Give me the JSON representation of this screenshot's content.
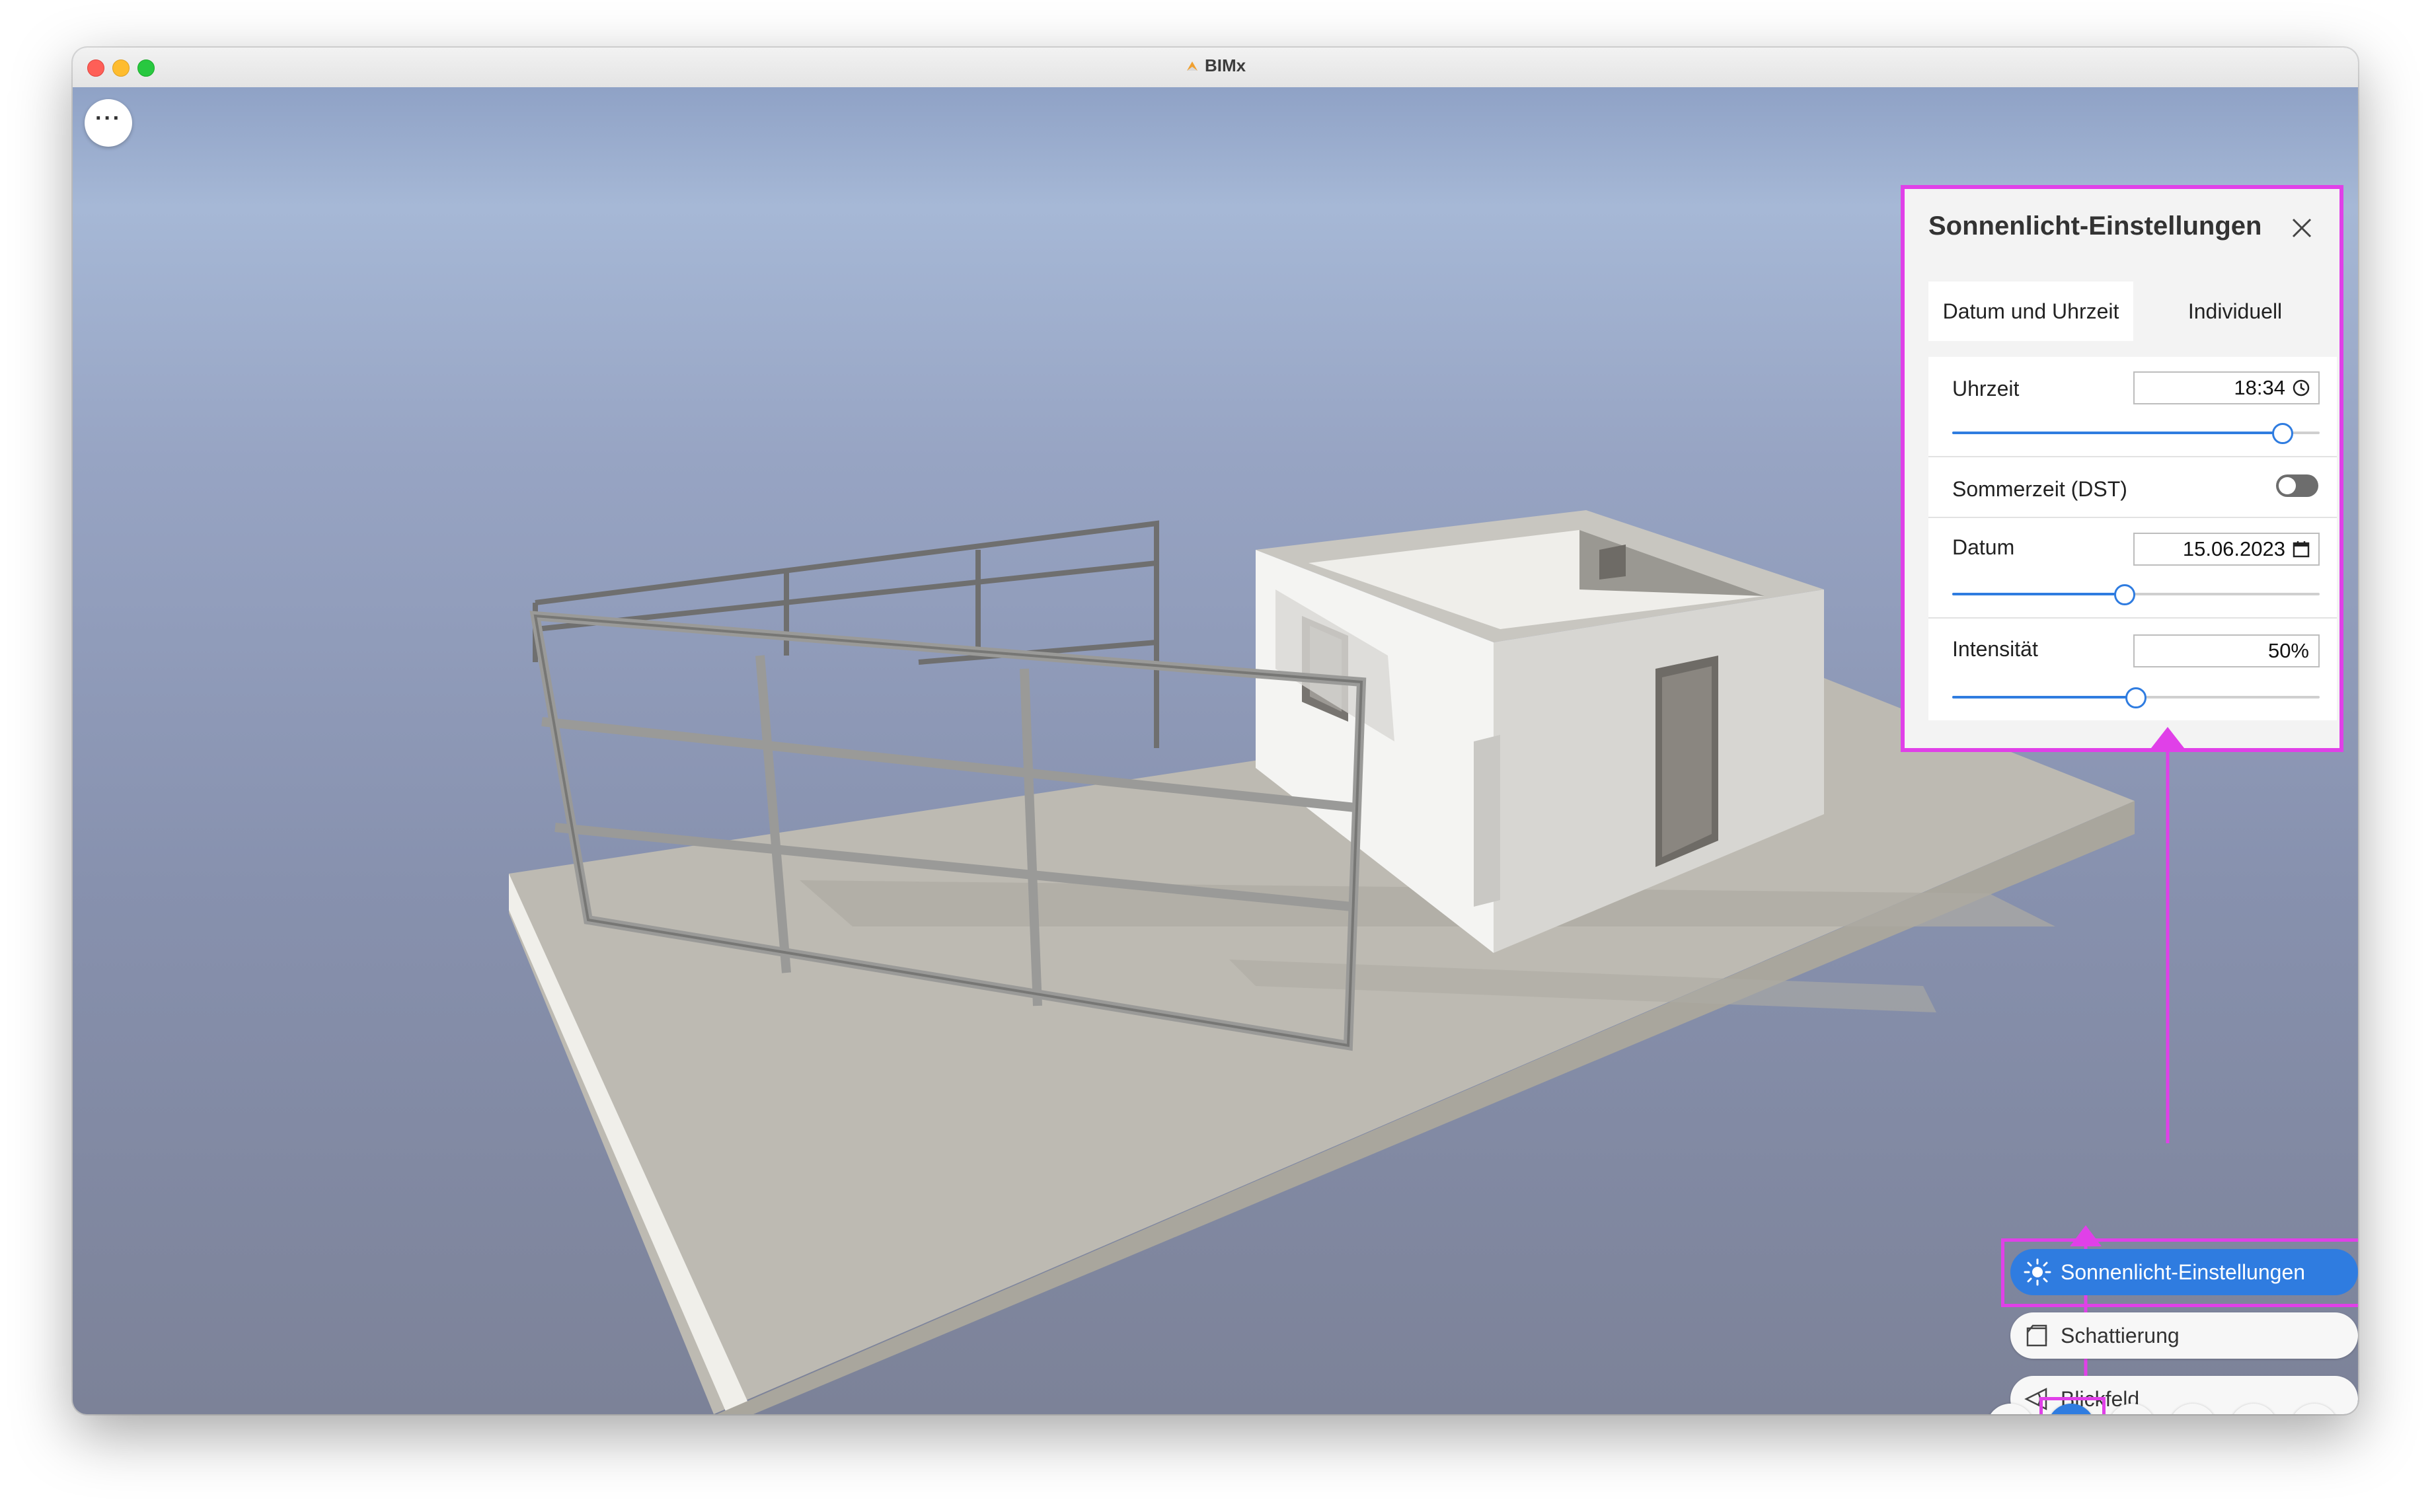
{
  "window": {
    "title": "BIMx"
  },
  "viewport": {
    "more_label": "···"
  },
  "sun_panel": {
    "title": "Sonnenlicht-Einstellungen",
    "tabs": [
      {
        "label": "Datum und Uhrzeit",
        "active": true
      },
      {
        "label": "Individuell",
        "active": false
      }
    ],
    "time": {
      "label": "Uhrzeit",
      "value": "18:34",
      "slider_fraction": 0.9
    },
    "dst": {
      "label": "Sommerzeit (DST)",
      "enabled": false
    },
    "date": {
      "label": "Datum",
      "value": "15.06.2023",
      "slider_fraction": 0.47
    },
    "intensity": {
      "label": "Intensität",
      "value": "50%",
      "slider_fraction": 0.5
    }
  },
  "menu": {
    "items": [
      {
        "label": "Sonnenlicht-Einstellungen",
        "icon": "sun-icon",
        "active": true
      },
      {
        "label": "Schattierung",
        "icon": "shading-icon",
        "active": false
      },
      {
        "label": "Blickfeld",
        "icon": "field-of-view-icon",
        "active": false
      }
    ]
  },
  "toolbar": {
    "buttons": [
      {
        "icon": "walk-icon",
        "active": false
      },
      {
        "icon": "settings-sliders-icon",
        "active": true
      },
      {
        "icon": "layers-icon",
        "active": false
      },
      {
        "icon": "measure-ruler-icon",
        "active": false
      },
      {
        "icon": "sheet-view-icon",
        "active": false
      },
      {
        "icon": "search-view-icon",
        "active": false
      }
    ]
  },
  "colors": {
    "accent": "#2f7ce0",
    "annotation": "#e040e8",
    "sky_top": "#8fa2c6",
    "ground": "#bdbab2"
  }
}
